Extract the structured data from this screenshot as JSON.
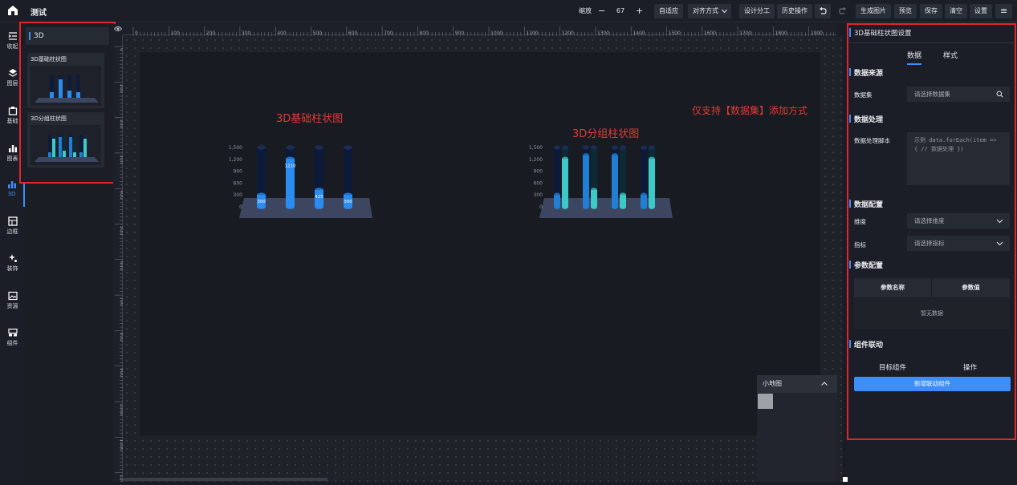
{
  "app": {
    "title": "测试"
  },
  "toolbar": {
    "zoom_label": "缩放",
    "zoom_minus": "−",
    "zoom_value": "67",
    "zoom_plus": "+",
    "fit": "自适应",
    "align": "对齐方式",
    "design_split": "设计分工",
    "history": "历史操作",
    "gen_image": "生成图片",
    "preview": "预览",
    "save": "保存",
    "clear": "清空",
    "settings": "设置",
    "menu_icon": "≡"
  },
  "leftnav": {
    "items": [
      {
        "label": "收起",
        "icon": "collapse-icon"
      },
      {
        "label": "图层",
        "icon": "layers-icon"
      },
      {
        "label": "基础",
        "icon": "basic-icon"
      },
      {
        "label": "图表",
        "icon": "chart-icon"
      },
      {
        "label": "3D",
        "icon": "3d-icon"
      },
      {
        "label": "边框",
        "icon": "border-icon"
      },
      {
        "label": "装饰",
        "icon": "decoration-icon"
      },
      {
        "label": "资源",
        "icon": "image-icon"
      },
      {
        "label": "组件",
        "icon": "component-icon"
      }
    ],
    "active": "3D"
  },
  "component_panel": {
    "category": "3D",
    "cards": [
      {
        "title": "3D基础柱状图"
      },
      {
        "title": "3D分组柱状图"
      }
    ]
  },
  "ruler": {
    "top_ticks": [
      "0",
      "100",
      "200",
      "300",
      "400",
      "500",
      "600",
      "700",
      "800",
      "900",
      "1000",
      "1100",
      "1200",
      "1300",
      "1400",
      "1500",
      "1600",
      "1700",
      "1800",
      "1900"
    ],
    "left_ticks": [
      "0",
      "100",
      "200",
      "300",
      "400",
      "500",
      "600",
      "700",
      "800",
      "900",
      "1000",
      "1100",
      "1200"
    ]
  },
  "canvas": {
    "annotation_left": "3D基础柱状图",
    "annotation_mid": "3D分组柱状图",
    "annotation_right": "仅支持【数据集】添加方式"
  },
  "chart_data": [
    {
      "type": "bar",
      "y_ticks": [
        "0",
        "300",
        "600",
        "900",
        "1,200",
        "1,500"
      ],
      "ylim": [
        0,
        1500
      ],
      "values": [
        300,
        1210,
        425,
        300
      ],
      "labels": [
        "300",
        "1210",
        "425",
        "300"
      ],
      "color": "#2a8cf0"
    },
    {
      "type": "bar",
      "y_ticks": [
        "0",
        "300",
        "600",
        "900",
        "1,200",
        "1,500"
      ],
      "ylim": [
        0,
        1500
      ],
      "series": [
        {
          "values": [
            300,
            1300,
            1300,
            300
          ],
          "color": "#1f7fd6"
        },
        {
          "values": [
            1210,
            425,
            300,
            1210
          ],
          "color": "#3ec9c9"
        }
      ]
    }
  ],
  "minimap": {
    "title": "小地图",
    "collapse_icon": "chevron-up-icon"
  },
  "right_panel": {
    "title": "3D基础柱状图设置",
    "tabs": [
      "数据",
      "样式"
    ],
    "active_tab": "数据",
    "sections": {
      "source": "数据来源",
      "process": "数据处理",
      "config": "数据配置",
      "params": "参数配置",
      "linkage": "组件联动"
    },
    "dataset_label": "数据集",
    "dataset_placeholder": "请选择数据集",
    "script_label": "数据处理脚本",
    "script_placeholder": "示例 data.forEach(item => { // 数据处理 })",
    "dimension_label": "维度",
    "dimension_placeholder": "请选择维度",
    "metric_label": "指标",
    "metric_placeholder": "请选择指标",
    "param_table": {
      "headers": [
        "参数名称",
        "参数值"
      ],
      "empty": "暂无数据"
    },
    "linkage_table": {
      "headers": [
        "目标组件",
        "操作"
      ]
    },
    "add_linkage": "新增联动组件"
  }
}
